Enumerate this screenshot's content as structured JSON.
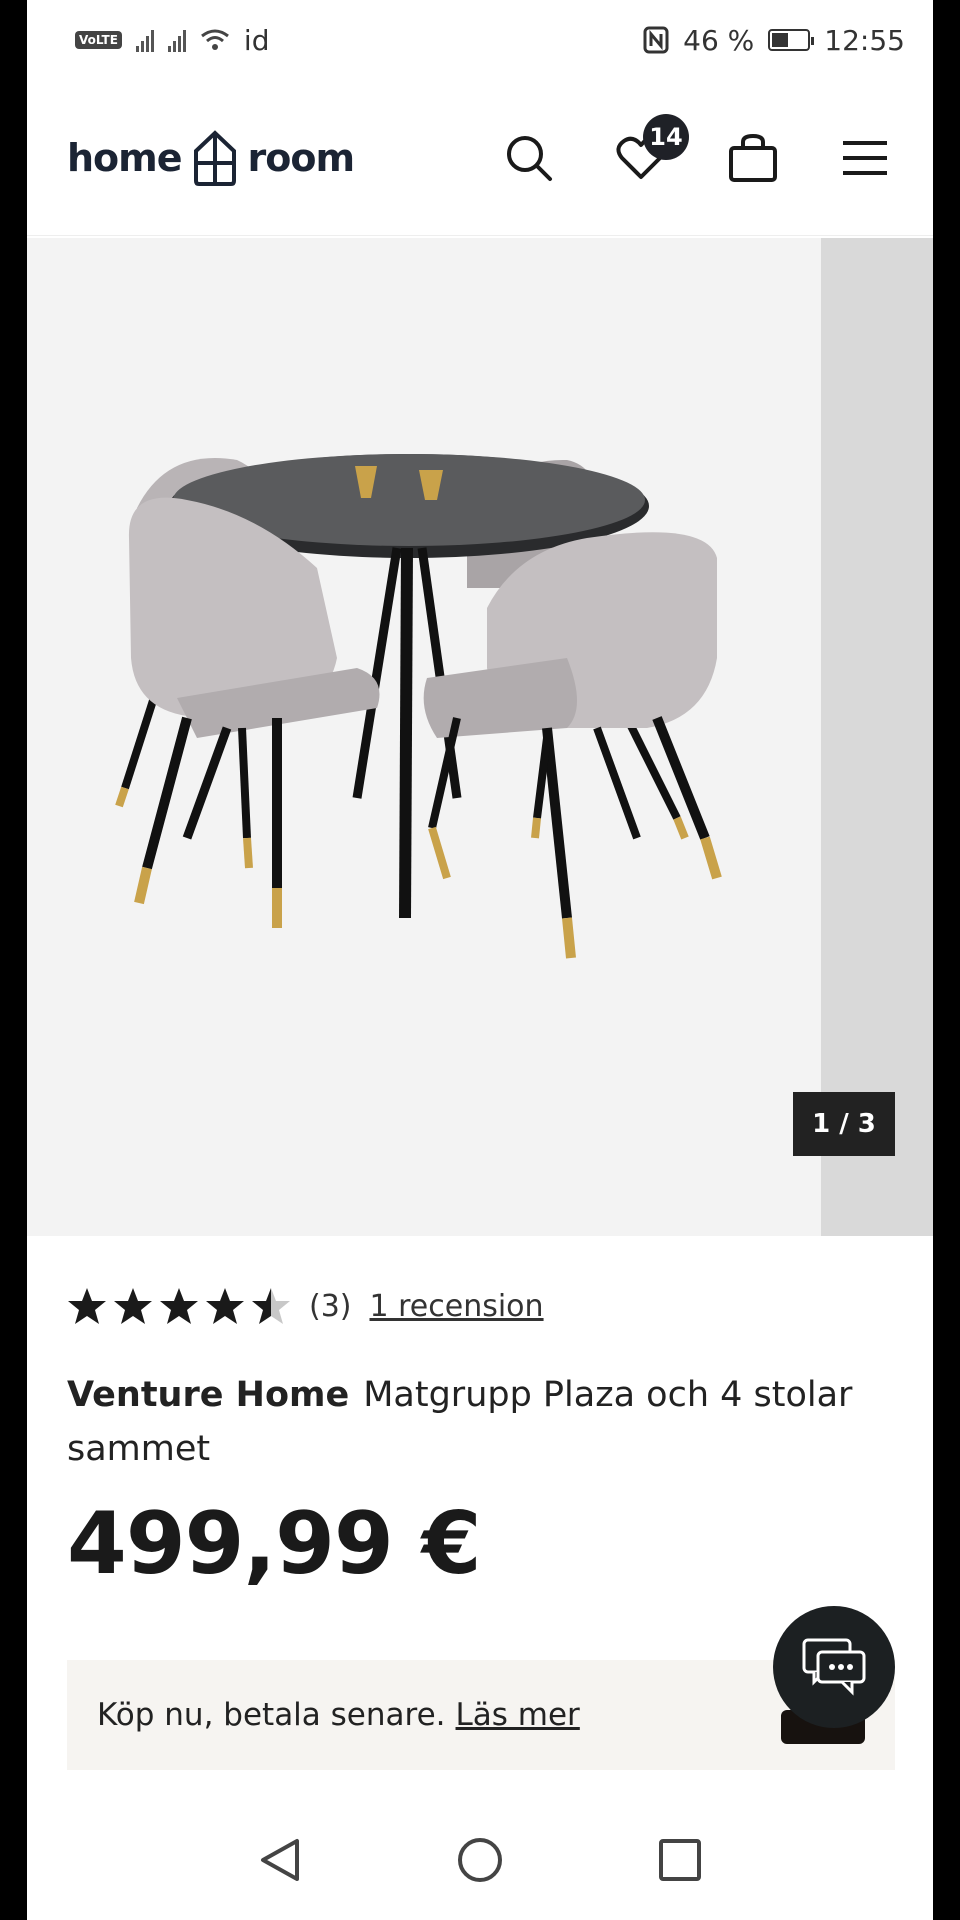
{
  "status_bar": {
    "volte": "VoLTE",
    "network_label": "id",
    "battery_percent": "46 %",
    "battery_level": 0.46,
    "time": "12:55"
  },
  "header": {
    "logo_left": "home",
    "logo_right": "room",
    "wishlist_count": "14",
    "icons": [
      "search-icon",
      "heart-icon",
      "bag-icon",
      "menu-icon"
    ]
  },
  "gallery": {
    "counter": "1 / 3"
  },
  "product": {
    "rating": 4.5,
    "rating_count": "(3)",
    "reviews_link": "1 recension",
    "brand": "Venture Home",
    "name": "Matgrupp Plaza och 4 stolar sammet",
    "price": "499,99 €"
  },
  "klarna": {
    "text": "Köp nu, betala senare.",
    "link": "Läs mer"
  },
  "colors": {
    "dark": "#1f2127",
    "klarna_bg": "#f6f4f1",
    "gold": "#c9a24a"
  }
}
